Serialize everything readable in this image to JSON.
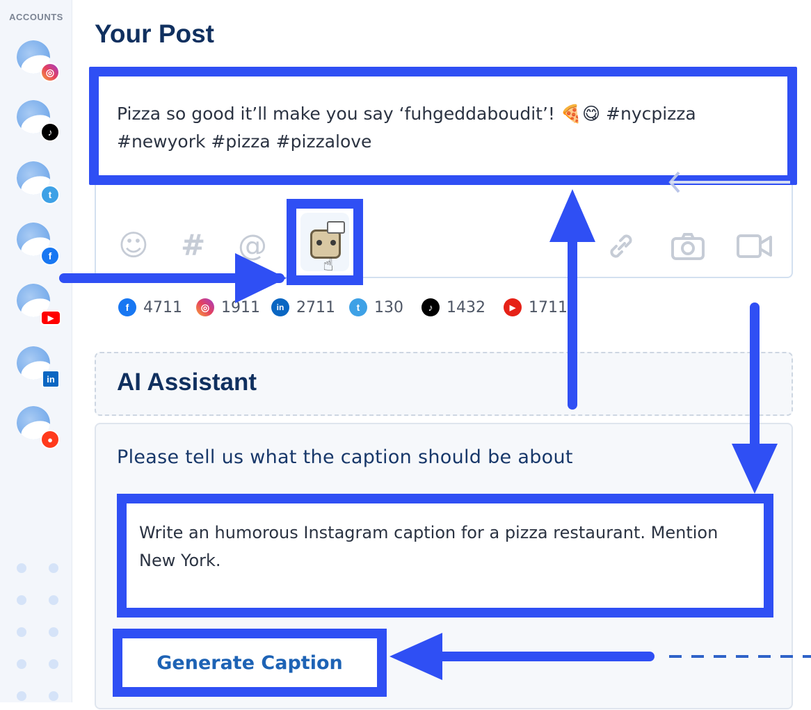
{
  "sidebar": {
    "title": "ACCOUNTS",
    "accounts": [
      {
        "network": "instagram",
        "icon": "instagram-icon"
      },
      {
        "network": "tiktok",
        "icon": "tiktok-icon"
      },
      {
        "network": "twitter",
        "icon": "twitter-icon"
      },
      {
        "network": "facebook",
        "icon": "facebook-icon"
      },
      {
        "network": "youtube",
        "icon": "youtube-icon"
      },
      {
        "network": "linkedin",
        "icon": "linkedin-icon"
      },
      {
        "network": "reddit",
        "icon": "reddit-icon"
      }
    ]
  },
  "post": {
    "title": "Your Post",
    "text": "Pizza so good it’ll make you say ‘fuhgeddaboudit’! 🍕😋 #nycpizza #newyork #pizza #pizzalove",
    "tools": {
      "emoji": "☺",
      "hashtag": "#",
      "mention": "@",
      "link": "🔗",
      "camera": "📷",
      "video": "▭"
    }
  },
  "stats": [
    {
      "network": "facebook",
      "icon": "facebook-icon",
      "count": "4711",
      "color": "#1877f2",
      "glyph": "f"
    },
    {
      "network": "instagram",
      "icon": "instagram-icon",
      "count": "1911",
      "color": "#e4405f",
      "glyph": "◎"
    },
    {
      "network": "linkedin",
      "icon": "linkedin-icon",
      "count": "2711",
      "color": "#0a66c2",
      "glyph": "in"
    },
    {
      "network": "twitter",
      "icon": "twitter-icon",
      "count": "130",
      "color": "#3ea1e6",
      "glyph": "t"
    },
    {
      "network": "tiktok",
      "icon": "tiktok-icon",
      "count": "1432",
      "color": "#000000",
      "glyph": "♪"
    },
    {
      "network": "youtube",
      "icon": "youtube-icon",
      "count": "1711",
      "color": "#e62117",
      "glyph": "▶"
    }
  ],
  "ai": {
    "title": "AI Assistant",
    "prompt_label": "Please tell us what the caption should be about",
    "prompt_value": "Write an humorous Instagram caption for a pizza restaurant. Mention New York.",
    "generate_label": "Generate Caption"
  },
  "colors": {
    "highlight": "#2f4ff4",
    "heading": "#10305f",
    "button_text": "#1e63b5"
  }
}
